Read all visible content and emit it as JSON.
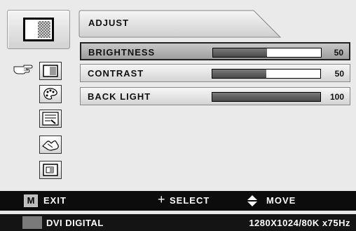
{
  "sidebar": {
    "main_icon": "picture-adjust-icon",
    "pointer_icon": "hand-pointer-icon",
    "items": [
      {
        "icon": "adjust-icon",
        "active": true
      },
      {
        "icon": "color-palette-icon",
        "active": false
      },
      {
        "icon": "setup-tools-icon",
        "active": false
      },
      {
        "icon": "hand-icon",
        "active": false
      },
      {
        "icon": "pip-icon",
        "active": false
      }
    ]
  },
  "header": {
    "title": "ADJUST"
  },
  "settings": [
    {
      "label": "BRIGHTNESS",
      "value": "50",
      "level": 0.5,
      "selected": true
    },
    {
      "label": "CONTRAST",
      "value": "50",
      "level": 0.5,
      "selected": false
    },
    {
      "label": "BACK LIGHT",
      "value": "100",
      "level": 1.0,
      "selected": false
    }
  ],
  "footer": {
    "menu_key": "M",
    "exit_label": "EXIT",
    "select_symbol": "+",
    "select_label": "SELECT",
    "move_label": "MOVE"
  },
  "status": {
    "input": "DVI DIGITAL",
    "mode": "1280X1024/80K x75Hz"
  },
  "colors": {
    "background": "#eaeaea",
    "selected_row": "#a8a8a8",
    "bar_fill": "#555555",
    "footer": "#0c0c0c"
  }
}
